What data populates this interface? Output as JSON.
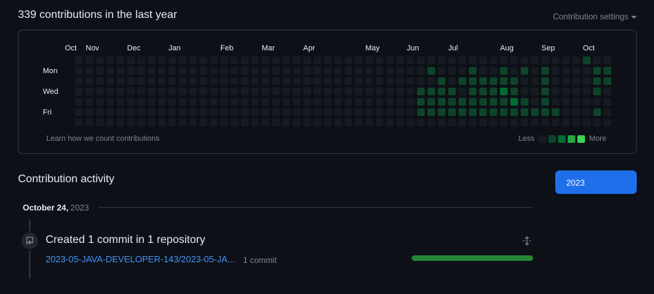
{
  "header": {
    "title": "339 contributions in the last year",
    "settings_label": "Contribution settings"
  },
  "calendar": {
    "months": [
      "Oct",
      "Nov",
      "Dec",
      "Jan",
      "Feb",
      "Mar",
      "Apr",
      "May",
      "Jun",
      "Jul",
      "Aug",
      "Sep",
      "Oct"
    ],
    "day_labels": [
      "Mon",
      "Wed",
      "Fri"
    ],
    "learn_link": "Learn how we count contributions",
    "legend_less": "Less",
    "legend_more": "More",
    "levels": [
      "0000000000000000000000000000000000000000000000000100",
      "0000000000000000000000000000000000100010010101000011",
      "0000000000000000000000000000000000010111111001000011",
      "0000000000000000000000000000000001111011121001000010",
      "0000000000000000000000000000000001111111112101000000",
      "0000000000000000000000000000000001111111111111100010",
      "0000000000000000000000000000000000000000000000000000"
    ]
  },
  "colors": {
    "accent": "#1f6feb",
    "link": "#4493f8",
    "level_colors": [
      "#161b22",
      "#0e4429",
      "#006d32",
      "#26a641",
      "#39d353"
    ]
  },
  "activity": {
    "title": "Contribution activity",
    "year_button": "2023",
    "date": "October 24,",
    "year": "2023",
    "commit_heading": "Created 1 commit in 1 repository",
    "repo_link": "2023-05-JAVA-DEVELOPER-143/2023-05-JA...",
    "commit_count": "1 commit",
    "commit_share": 1.0
  },
  "icons": {
    "commit": "repo-push-icon",
    "collapse": "fold-icon"
  }
}
